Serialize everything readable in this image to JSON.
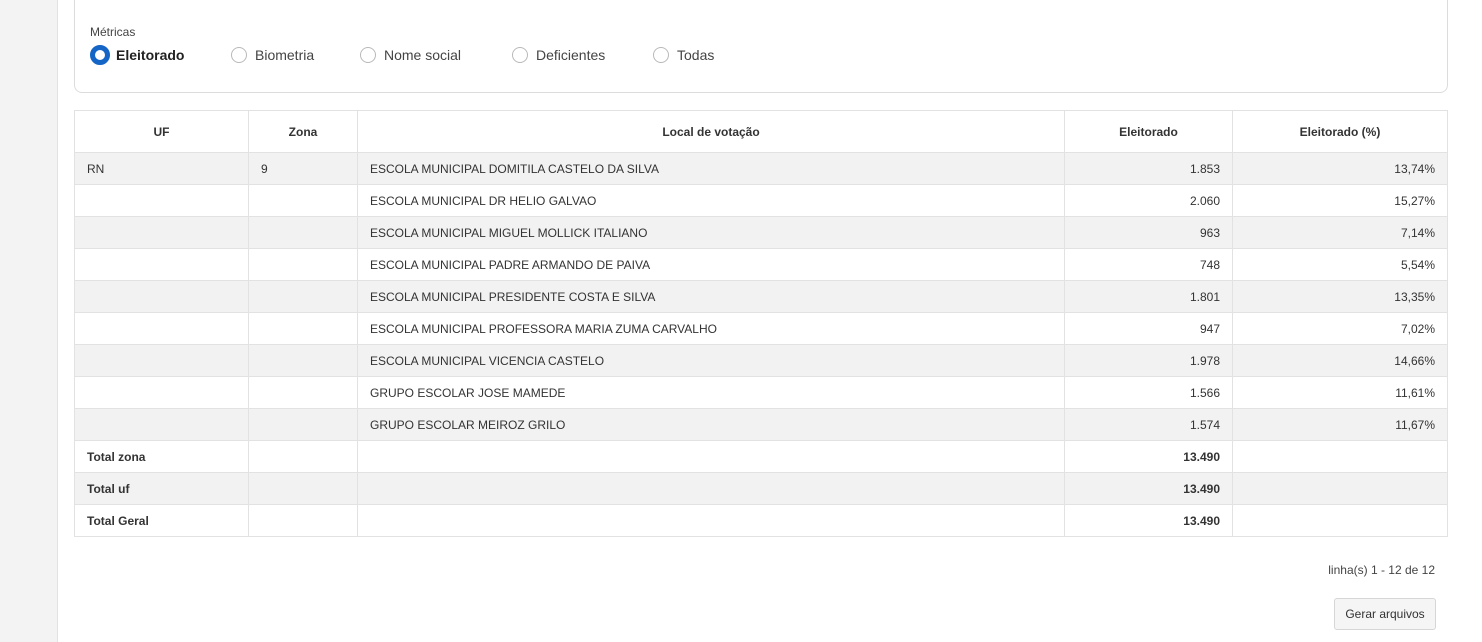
{
  "metrics": {
    "label": "Métricas",
    "options": [
      {
        "label": "Eleitorado",
        "selected": true
      },
      {
        "label": "Biometria",
        "selected": false
      },
      {
        "label": "Nome social",
        "selected": false
      },
      {
        "label": "Deficientes",
        "selected": false
      },
      {
        "label": "Todas",
        "selected": false
      }
    ]
  },
  "table": {
    "columns": [
      "UF",
      "Zona",
      "Local de votação",
      "Eleitorado",
      "Eleitorado (%)"
    ],
    "rows": [
      [
        "RN",
        "9",
        "ESCOLA MUNICIPAL DOMITILA CASTELO DA SILVA",
        "1.853",
        "13,74%"
      ],
      [
        "",
        "",
        "ESCOLA MUNICIPAL DR HELIO GALVAO",
        "2.060",
        "15,27%"
      ],
      [
        "",
        "",
        "ESCOLA MUNICIPAL MIGUEL MOLLICK ITALIANO",
        "963",
        "7,14%"
      ],
      [
        "",
        "",
        "ESCOLA MUNICIPAL PADRE ARMANDO DE PAIVA",
        "748",
        "5,54%"
      ],
      [
        "",
        "",
        "ESCOLA MUNICIPAL PRESIDENTE COSTA E SILVA",
        "1.801",
        "13,35%"
      ],
      [
        "",
        "",
        "ESCOLA MUNICIPAL PROFESSORA MARIA ZUMA CARVALHO",
        "947",
        "7,02%"
      ],
      [
        "",
        "",
        "ESCOLA MUNICIPAL VICENCIA CASTELO",
        "1.978",
        "14,66%"
      ],
      [
        "",
        "",
        "GRUPO ESCOLAR JOSE MAMEDE",
        "1.566",
        "11,61%"
      ],
      [
        "",
        "",
        "GRUPO ESCOLAR MEIROZ GRILO",
        "1.574",
        "11,67%"
      ]
    ],
    "totals": [
      [
        "Total zona",
        "",
        "",
        "13.490",
        ""
      ],
      [
        "Total uf",
        "",
        "",
        "13.490",
        ""
      ],
      [
        "Total Geral",
        "",
        "",
        "13.490",
        ""
      ]
    ]
  },
  "pagination": {
    "text": "linha(s) 1 - 12 de 12"
  },
  "actions": {
    "generate_label": "Gerar arquivos"
  }
}
